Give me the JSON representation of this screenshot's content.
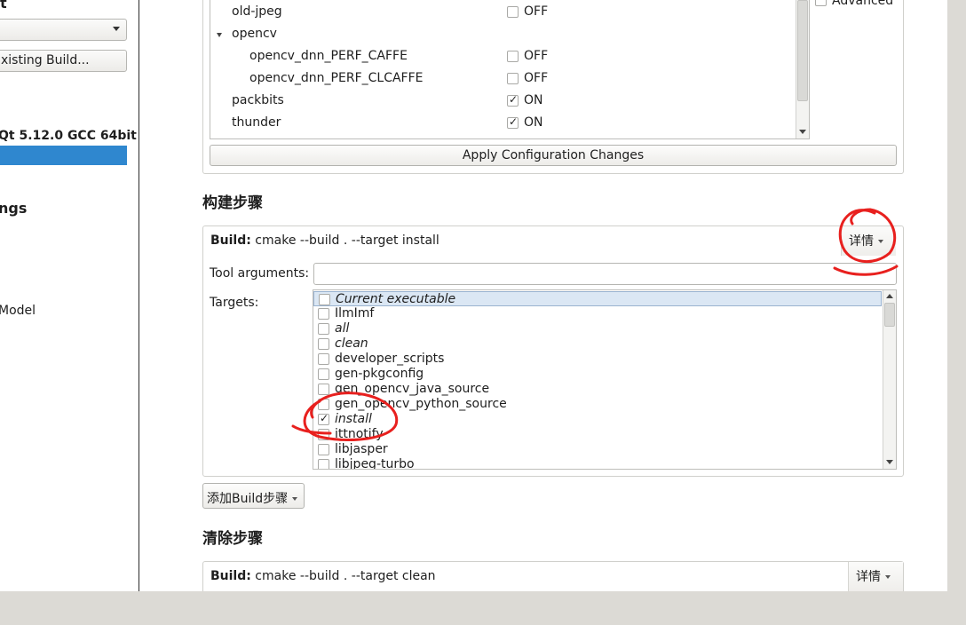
{
  "sidebar": {
    "heading_fragment": "t",
    "combo_value": "",
    "existing_build_button": "xisting Build...",
    "kit_label": "Qt 5.12.0 GCC 64bit",
    "settings_fragment": "ngs",
    "model_fragment": "Model",
    "selected_color": "#2f87cf"
  },
  "cmake_config": {
    "rows": [
      {
        "label": "old-jpeg",
        "checked": false,
        "value": "OFF",
        "indent": 1
      },
      {
        "label": "opencv",
        "group": true,
        "indent": 0
      },
      {
        "label": "opencv_dnn_PERF_CAFFE",
        "checked": false,
        "value": "OFF",
        "indent": 2
      },
      {
        "label": "opencv_dnn_PERF_CLCAFFE",
        "checked": false,
        "value": "OFF",
        "indent": 2
      },
      {
        "label": "packbits",
        "checked": true,
        "value": "ON",
        "indent": 1
      },
      {
        "label": "thunder",
        "checked": true,
        "value": "ON",
        "indent": 1
      }
    ],
    "advanced_label": "Advanced",
    "apply_button": "Apply Configuration Changes"
  },
  "build_steps": {
    "title": "构建步骤",
    "step_prefix": "Build:",
    "step_command": " cmake --build . --target install",
    "details_button": "详情",
    "tool_args_label": "Tool arguments:",
    "tool_args_value": "",
    "targets_label": "Targets:",
    "targets": [
      {
        "name": "Current executable",
        "checked": false,
        "italic": true,
        "selected": true
      },
      {
        "name": "IlmImf",
        "checked": false,
        "italic": false
      },
      {
        "name": "all",
        "checked": false,
        "italic": true
      },
      {
        "name": "clean",
        "checked": false,
        "italic": true
      },
      {
        "name": "developer_scripts",
        "checked": false,
        "italic": false
      },
      {
        "name": "gen-pkgconfig",
        "checked": false,
        "italic": false
      },
      {
        "name": "gen_opencv_java_source",
        "checked": false,
        "italic": false
      },
      {
        "name": "gen_opencv_python_source",
        "checked": false,
        "italic": false
      },
      {
        "name": "install",
        "checked": true,
        "italic": true
      },
      {
        "name": "ittnotify",
        "checked": false,
        "italic": false
      },
      {
        "name": "libjasper",
        "checked": false,
        "italic": false
      },
      {
        "name": "libjpeg-turbo",
        "checked": false,
        "italic": false
      }
    ],
    "add_step_button": "添加Build步骤"
  },
  "clean_steps": {
    "title": "清除步骤",
    "step_prefix": "Build:",
    "step_command": " cmake --build . --target clean",
    "details_button": "详情"
  },
  "colors": {
    "annotation": "#e8201e",
    "selection": "#dbe7f4"
  }
}
